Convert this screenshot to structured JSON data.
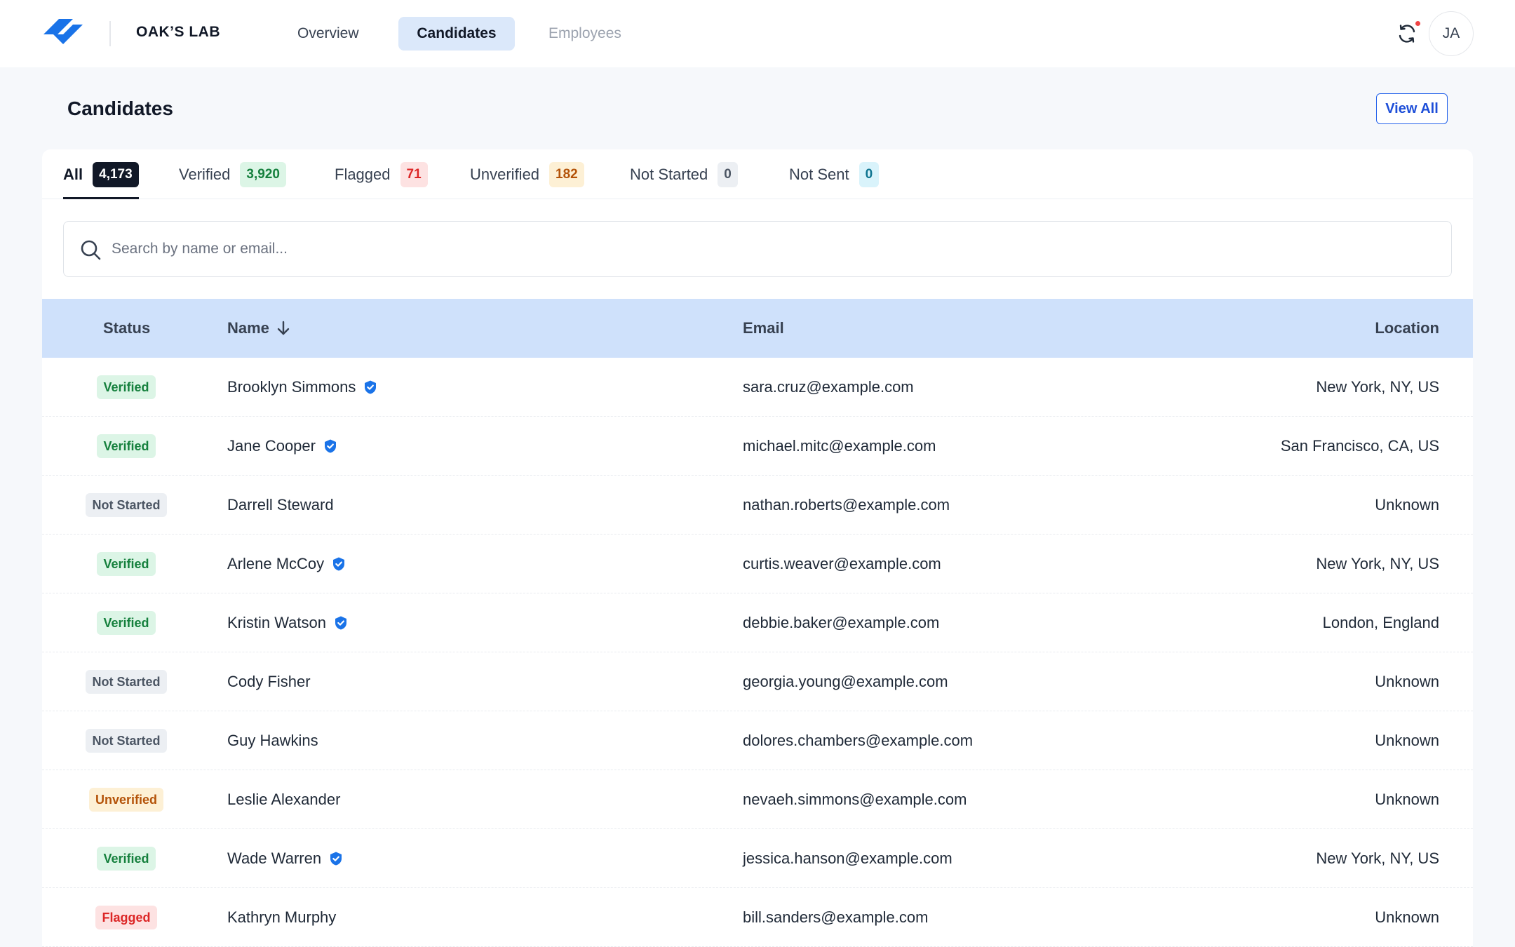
{
  "app": {
    "org_name": "OAK’S LAB",
    "nav": [
      {
        "label": "Overview"
      },
      {
        "label": "Candidates"
      },
      {
        "label": "Employees"
      }
    ],
    "avatar_initials": "JA",
    "brand_color": "#1a73e8"
  },
  "page": {
    "title": "Candidates",
    "view_all_label": "View All"
  },
  "filters": [
    {
      "label": "All",
      "count": "4,173"
    },
    {
      "label": "Verified",
      "count": "3,920"
    },
    {
      "label": "Flagged",
      "count": "71"
    },
    {
      "label": "Unverified",
      "count": "182"
    },
    {
      "label": "Not Started",
      "count": "0"
    },
    {
      "label": "Not Sent",
      "count": "0"
    }
  ],
  "search": {
    "placeholder": "Search by name or email...",
    "value": ""
  },
  "table": {
    "columns": {
      "status": "Status",
      "name": "Name",
      "email": "Email",
      "location": "Location"
    },
    "sort": {
      "column": "name",
      "direction": "desc"
    },
    "rows": [
      {
        "status": "Verified",
        "name": "Brooklyn Simmons",
        "verified_icon": true,
        "email": "sara.cruz@example.com",
        "location": "New York, NY, US"
      },
      {
        "status": "Verified",
        "name": "Jane Cooper",
        "verified_icon": true,
        "email": "michael.mitc@example.com",
        "location": "San Francisco, CA, US"
      },
      {
        "status": "Not Started",
        "name": "Darrell Steward",
        "verified_icon": false,
        "email": "nathan.roberts@example.com",
        "location": "Unknown"
      },
      {
        "status": "Verified",
        "name": "Arlene McCoy",
        "verified_icon": true,
        "email": "curtis.weaver@example.com",
        "location": "New York, NY, US"
      },
      {
        "status": "Verified",
        "name": "Kristin Watson",
        "verified_icon": true,
        "email": "debbie.baker@example.com",
        "location": "London, England"
      },
      {
        "status": "Not Started",
        "name": "Cody Fisher",
        "verified_icon": false,
        "email": "georgia.young@example.com",
        "location": "Unknown"
      },
      {
        "status": "Not Started",
        "name": "Guy Hawkins",
        "verified_icon": false,
        "email": "dolores.chambers@example.com",
        "location": "Unknown"
      },
      {
        "status": "Unverified",
        "name": "Leslie Alexander",
        "verified_icon": false,
        "email": "nevaeh.simmons@example.com",
        "location": "Unknown"
      },
      {
        "status": "Verified",
        "name": "Wade Warren",
        "verified_icon": true,
        "email": "jessica.hanson@example.com",
        "location": "New York, NY, US"
      },
      {
        "status": "Flagged",
        "name": "Kathryn Murphy",
        "verified_icon": false,
        "email": "bill.sanders@example.com",
        "location": "Unknown"
      }
    ]
  }
}
